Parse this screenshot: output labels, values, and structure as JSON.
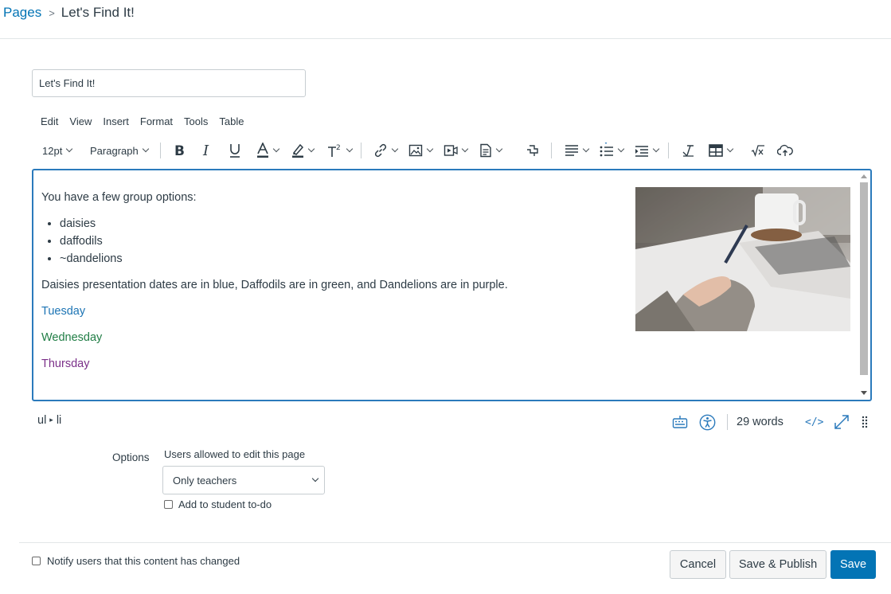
{
  "breadcrumb": {
    "parent": "Pages",
    "separator": ">",
    "current": "Let's Find It!"
  },
  "title_input": {
    "value": "Let's Find It!"
  },
  "menubar": {
    "items": [
      "Edit",
      "View",
      "Insert",
      "Format",
      "Tools",
      "Table"
    ]
  },
  "toolbar": {
    "font_size": "12pt",
    "block_format": "Paragraph",
    "icons": [
      "bold-icon",
      "italic-icon",
      "underline-icon",
      "text-color-icon",
      "highlight-icon",
      "superscript-icon",
      "link-icon",
      "image-icon",
      "media-icon",
      "document-icon",
      "apps-icon",
      "align-icon",
      "bullet-list-icon",
      "indent-icon",
      "clear-formatting-icon",
      "table-icon",
      "equation-icon",
      "upload-cloud-icon"
    ]
  },
  "editor": {
    "intro": "You have a few group options:",
    "groups": [
      "daisies",
      "daffodils",
      "~dandelions"
    ],
    "dates_sentence": "Daisies  presentation dates are in blue, Daffodils  are in green, and Dandelions are in purple.",
    "days": {
      "tuesday": "Tuesday",
      "wednesday": "Wednesday",
      "thursday": "Thursday"
    },
    "colors": {
      "tuesday": "#1c74b4",
      "wednesday": "#217e46",
      "thursday": "#7b3089"
    }
  },
  "statusbar": {
    "path_parent": "ul",
    "path_child": "li",
    "path_separator": "▸",
    "word_count": "29 words",
    "html_toggle": "</>",
    "icons": [
      "keyboard-icon",
      "accessibility-icon",
      "fullscreen-icon",
      "resize-handle-icon"
    ]
  },
  "options": {
    "label": "Options",
    "permissions_label": "Users allowed to edit this page",
    "permissions_value": "Only teachers",
    "todo_label": "Add to student to-do",
    "todo_checked": false
  },
  "footer": {
    "notify_label": "Notify users that this content has changed",
    "notify_checked": false,
    "cancel": "Cancel",
    "save_publish": "Save & Publish",
    "save": "Save"
  },
  "theme": {
    "accent": "#0374b5",
    "editor_border": "#2b7abc",
    "text": "#2d3b45"
  }
}
